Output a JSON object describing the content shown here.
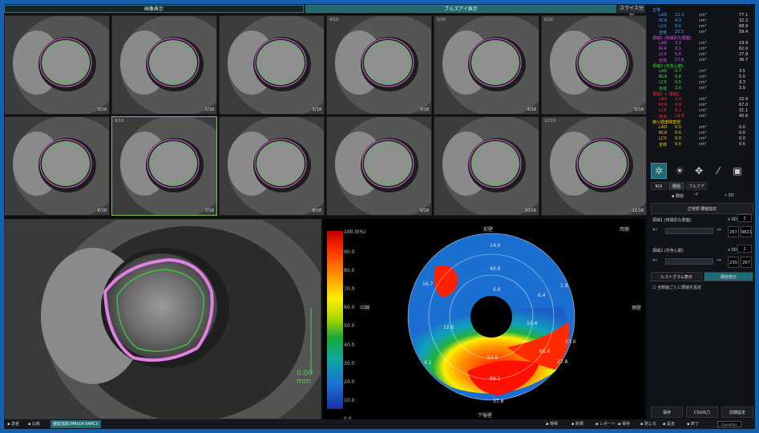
{
  "tabs": {
    "cine": "画像表示",
    "bullseye": "ブルズアイ表示",
    "slice": "スライス分割"
  },
  "thumbnails": [
    {
      "num": "",
      "pos": "0/18"
    },
    {
      "num": "",
      "pos": "1/18"
    },
    {
      "num": "",
      "pos": "2/18"
    },
    {
      "num": "4/10",
      "pos": "3/18"
    },
    {
      "num": "5/10",
      "pos": "4/18"
    },
    {
      "num": "6/10",
      "pos": "5/18"
    },
    {
      "num": "",
      "pos": "6/18"
    },
    {
      "num": "9/10",
      "pos": "7/18"
    },
    {
      "num": "",
      "pos": "8/18"
    },
    {
      "num": "",
      "pos": "9/18"
    },
    {
      "num": "",
      "pos": "10/18"
    },
    {
      "num": "12/10",
      "pos": "11/18"
    }
  ],
  "mainview": {
    "scale": "0.00 mm"
  },
  "colorbar": {
    "unit": "100.0(%)",
    "ticks": [
      "90.0",
      "80.0",
      "70.0",
      "60.0",
      "50.0",
      "40.0",
      "30.0",
      "20.0",
      "10.0",
      "0.0"
    ]
  },
  "bullseye": {
    "labels": {
      "anterior": "前壁",
      "inferior": "下後壁",
      "septal": "中隔",
      "lateral": "側壁",
      "lateral2": "両側"
    },
    "values": [
      "14.0",
      "40.9",
      "1.9",
      "16.7",
      "0.6",
      "6.4",
      "10.4",
      "12.6",
      "23.0",
      "54.6",
      "66.6",
      "27.8",
      "4.1",
      "99.1",
      "37.8"
    ]
  },
  "stats": {
    "groups": [
      {
        "title": "正常",
        "color": "#4aa0ff",
        "rows": [
          {
            "name": "LAD",
            "val": "12.3",
            "unit": "cm²",
            "pct": "77.1"
          },
          {
            "name": "RCA",
            "val": "4.3",
            "unit": "cm²",
            "pct": "32.2"
          },
          {
            "name": "LCX",
            "val": "9.0",
            "unit": "cm²",
            "pct": "68.9"
          },
          {
            "name": "全体",
            "val": "25.5",
            "unit": "cm²",
            "pct": "59.4"
          }
        ]
      },
      {
        "title": "領域1 (特異的な梗塞)",
        "color": "#e050ff",
        "rows": [
          {
            "name": "LAD",
            "val": "3.2",
            "unit": "cm²",
            "pct": "19.4"
          },
          {
            "name": "RCA",
            "val": "9.1",
            "unit": "cm²",
            "pct": "62.0"
          },
          {
            "name": "LCX",
            "val": "5.6",
            "unit": "cm²",
            "pct": "27.8"
          },
          {
            "name": "全体",
            "val": "17.8",
            "unit": "cm²",
            "pct": "36.7"
          }
        ]
      },
      {
        "title": "領域2 (灰色心筋)",
        "color": "#40e040",
        "rows": [
          {
            "name": "LAD",
            "val": "0.7",
            "unit": "cm²",
            "pct": "3.5"
          },
          {
            "name": "RCA",
            "val": "0.8",
            "unit": "cm²",
            "pct": "5.0"
          },
          {
            "name": "LCX",
            "val": "0.5",
            "unit": "cm²",
            "pct": "3.3"
          },
          {
            "name": "全体",
            "val": "2.0",
            "unit": "cm²",
            "pct": "3.9"
          }
        ]
      },
      {
        "title": "領域1 + 領域2",
        "color": "#ff3030",
        "rows": [
          {
            "name": "LAD",
            "val": "3.9",
            "unit": "cm²",
            "pct": "22.9"
          },
          {
            "name": "RCA",
            "val": "9.9",
            "unit": "cm²",
            "pct": "67.0"
          },
          {
            "name": "LCX",
            "val": "6.1",
            "unit": "cm²",
            "pct": "31.1"
          },
          {
            "name": "全体",
            "val": "19.8",
            "unit": "cm²",
            "pct": "40.6"
          }
        ]
      },
      {
        "title": "微小循環障害部",
        "color": "#ffd000",
        "rows": [
          {
            "name": "LAD",
            "val": "0.0",
            "unit": "cm²",
            "pct": "0.0"
          },
          {
            "name": "RCA",
            "val": "0.0",
            "unit": "cm²",
            "pct": "0.0"
          },
          {
            "name": "LCX",
            "val": "0.0",
            "unit": "cm²",
            "pct": "0.0"
          },
          {
            "name": "全体",
            "val": "0.0",
            "unit": "cm²",
            "pct": "0.0"
          }
        ]
      }
    ]
  },
  "panel": {
    "subtabs": [
      "ROI",
      "閾値",
      "ブルズアイ"
    ],
    "check_label": "閾値",
    "mode_label": "3D",
    "normal_btn": "正常部 閾値指定",
    "region1_label": "領域1 (特異的な梗塞)",
    "region1_sd": "x SD",
    "region1_sd_val": "2",
    "region1_vals": [
      "267",
      "4821"
    ],
    "region2_label": "領域2 (灰色心筋)",
    "region2_sd": "x SD",
    "region2_sd_val": "2",
    "region2_vals": [
      "230",
      "267"
    ],
    "histogram_btn": "ヒストグラム表示",
    "threshold_btn": "閾値表示",
    "apply_label": "全断面ごとに閾値を設定",
    "bottom_btns": [
      "保存",
      "CSV出力",
      "詳細設定"
    ]
  },
  "bottombar": {
    "items": [
      "患者",
      "比較"
    ],
    "study": "遅延造影(MRI)(A-SARCI)",
    "right_items": [
      "特殊",
      "新規",
      "レポート",
      "保存",
      "閉じる",
      "設定",
      "終了"
    ],
    "endtag": "Ziostation"
  },
  "colors": {
    "accent": "#1f6b73",
    "frame": "#1560b0"
  }
}
